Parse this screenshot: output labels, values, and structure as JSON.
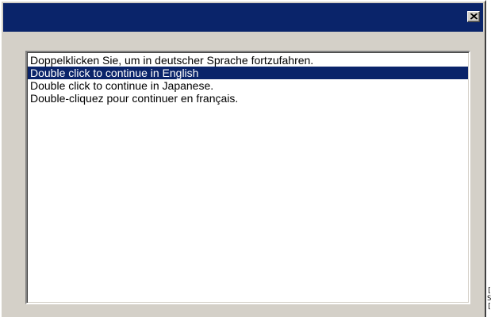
{
  "window": {
    "title": "",
    "close_icon": "close-icon"
  },
  "language_list": {
    "selected_index": 1,
    "items": [
      {
        "label": "Doppelklicken Sie, um in deutscher Sprache fortzufahren."
      },
      {
        "label": "Double click to continue in English"
      },
      {
        "label": "Double click to continue in Japanese."
      },
      {
        "label": "Double-cliquez pour continuer en français."
      }
    ]
  },
  "colors": {
    "titlebar": "#0a246a",
    "dialog_face": "#d4d0c8",
    "selection": "#0a246a",
    "list_background": "#ffffff"
  }
}
